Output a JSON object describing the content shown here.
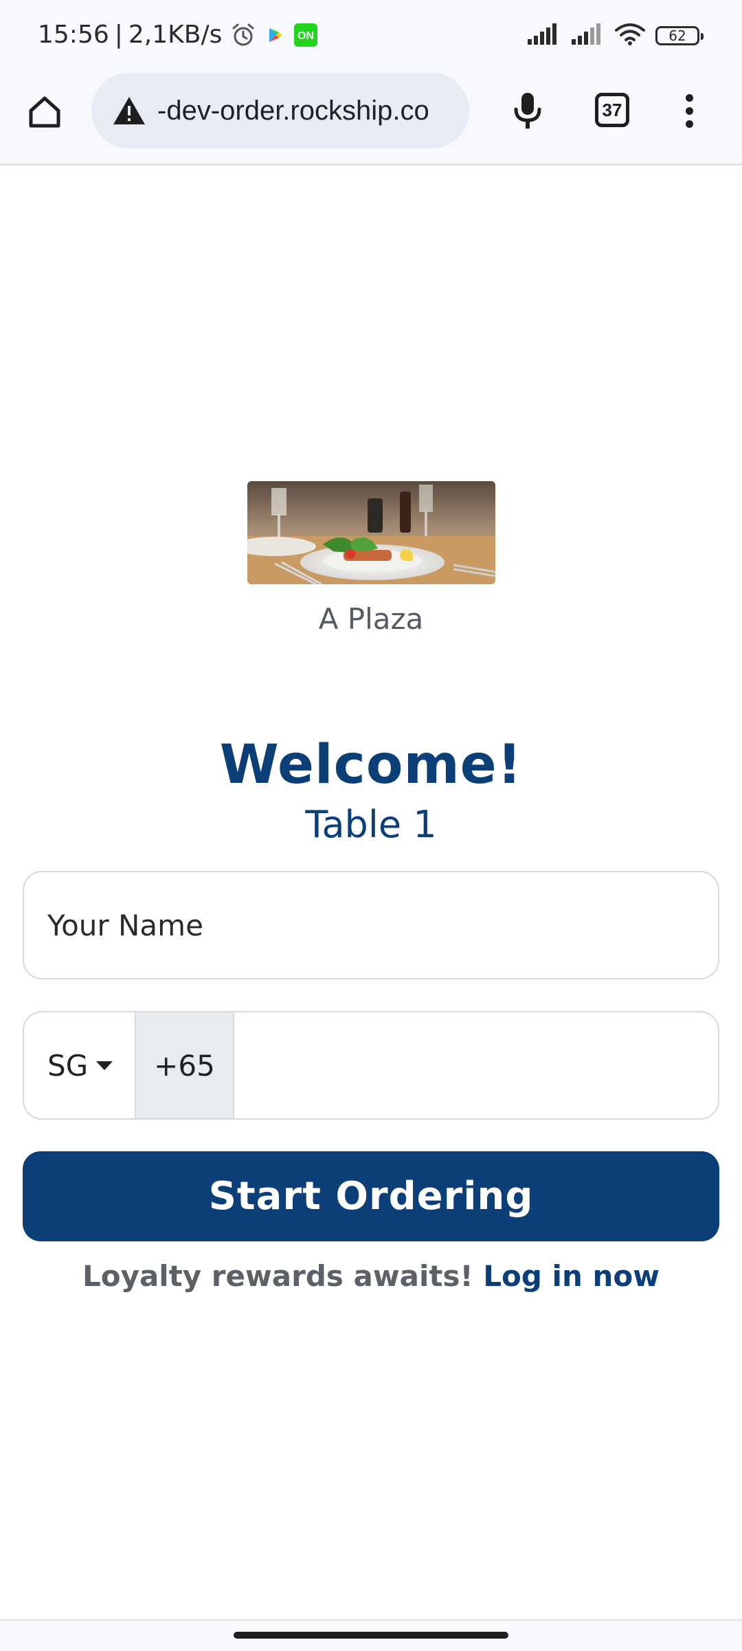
{
  "status_bar": {
    "time": "15:56",
    "separator": "|",
    "net_speed": "2,1KB/s",
    "battery": "62",
    "icons": [
      "alarm-icon",
      "play-store-icon",
      "on-app-icon",
      "signal-icon",
      "signal-icon",
      "wifi-icon",
      "battery-icon"
    ]
  },
  "browser": {
    "url": "-dev-order.rockship.co",
    "tab_count": "37",
    "icons": [
      "home-icon",
      "warning-icon",
      "mic-icon",
      "tabs-icon",
      "menu-icon"
    ]
  },
  "restaurant": {
    "name": "A Plaza"
  },
  "welcome": {
    "title": "Welcome!",
    "table": "Table 1"
  },
  "form": {
    "name_placeholder": "Your Name",
    "country": "SG",
    "dial_code": "+65",
    "phone_value": "",
    "submit_label": "Start Ordering"
  },
  "loyalty": {
    "text": "Loyalty rewards awaits!",
    "link": "Log in now"
  },
  "colors": {
    "primary": "#0c3f78",
    "muted_text": "#5c6167",
    "border": "#d6d9dd",
    "chrome_bg": "#f8f9fd",
    "url_bg": "#e7ebf3"
  }
}
